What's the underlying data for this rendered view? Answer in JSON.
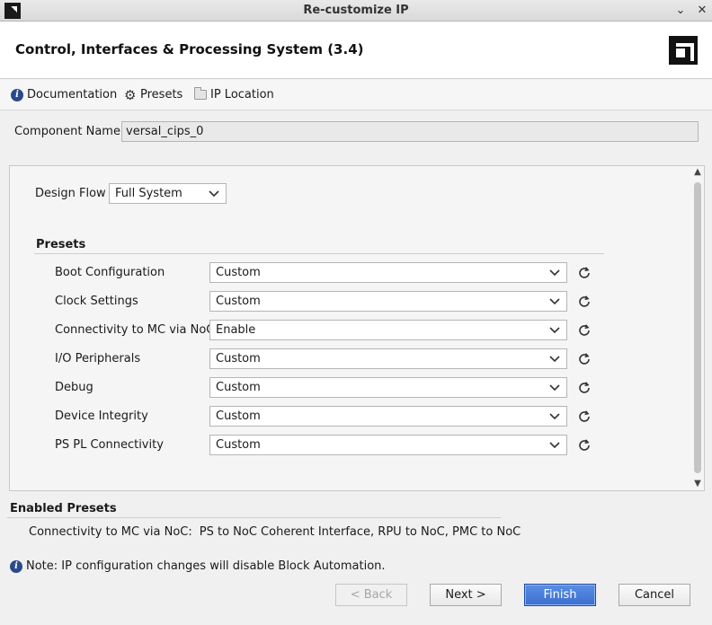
{
  "window": {
    "title": "Re-customize IP",
    "minimize_glyph": "⌄",
    "close_glyph": "✕"
  },
  "header": {
    "title": "Control, Interfaces & Processing System (3.4)"
  },
  "toolbar": {
    "documentation_label": "Documentation",
    "presets_label": "Presets",
    "ip_location_label": "IP Location"
  },
  "component": {
    "label": "Component Name",
    "value": "versal_cips_0"
  },
  "design_flow": {
    "label": "Design Flow",
    "value": "Full System"
  },
  "presets": {
    "heading": "Presets",
    "rows": [
      {
        "label": "Boot Configuration",
        "value": "Custom"
      },
      {
        "label": "Clock Settings",
        "value": "Custom"
      },
      {
        "label": "Connectivity to MC via NoC",
        "value": "Enable"
      },
      {
        "label": "I/O Peripherals",
        "value": "Custom"
      },
      {
        "label": "Debug",
        "value": "Custom"
      },
      {
        "label": "Device Integrity",
        "value": "Custom"
      },
      {
        "label": "PS PL Connectivity",
        "value": "Custom"
      }
    ]
  },
  "enabled_presets": {
    "heading": "Enabled Presets",
    "key": "Connectivity to MC via NoC:",
    "value": "PS to NoC Coherent Interface, RPU to NoC, PMC to NoC"
  },
  "note": {
    "text": "Note: IP configuration changes will disable Block Automation."
  },
  "buttons": {
    "back": "< Back",
    "next": "Next >",
    "finish": "Finish",
    "cancel": "Cancel"
  },
  "icons": {
    "info": "info-icon",
    "gear": "gear-icon",
    "folder": "folder-icon",
    "reset": "refresh-icon",
    "chevron": "chevron-down-icon"
  },
  "colors": {
    "accent": "#3a6fce",
    "info_icon": "#2b4a8a"
  }
}
